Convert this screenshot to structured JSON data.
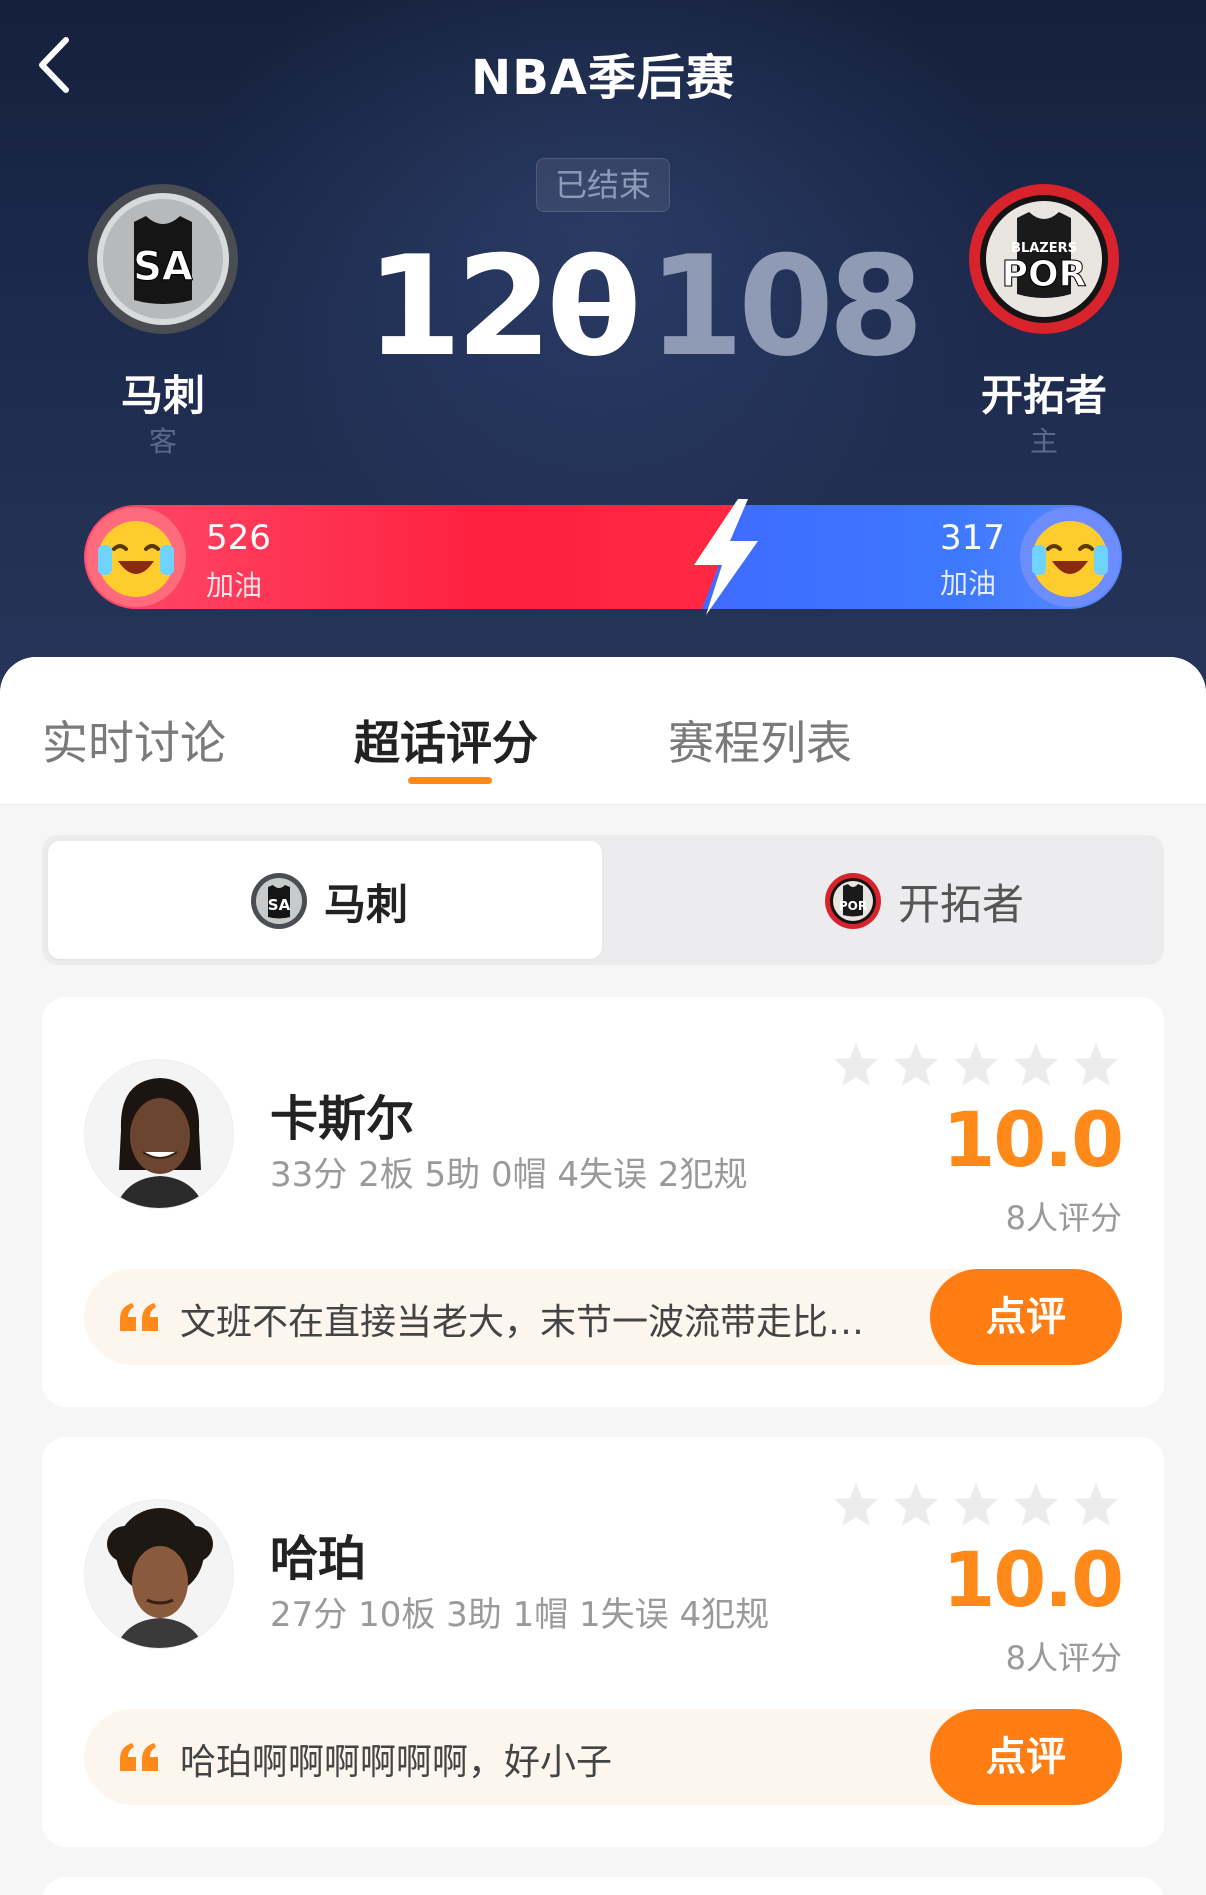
{
  "nav": {
    "title": "NBA季后赛"
  },
  "match": {
    "status": "已结束",
    "away": {
      "name": "马刺",
      "role": "客",
      "score": "120",
      "logo_text": "SA",
      "color": "#1a1a1a"
    },
    "home": {
      "name": "开拓者",
      "role": "主",
      "score": "108",
      "logo_text": "POR",
      "color": "#e0262e"
    }
  },
  "cheer": {
    "away_count": "526",
    "away_label": "加油",
    "home_count": "317",
    "home_label": "加油",
    "away_share": 0.624
  },
  "tabs": [
    {
      "label": "实时讨论",
      "active": false
    },
    {
      "label": "超话评分",
      "active": true
    },
    {
      "label": "赛程列表",
      "active": false
    }
  ],
  "team_switch": {
    "active": {
      "label": "马刺"
    },
    "inactive": {
      "label": "开拓者"
    }
  },
  "players": [
    {
      "name": "卡斯尔",
      "stats": "33分 2板 5助 0帽 4失误 2犯规",
      "score": "10.0",
      "rating_count": "8人评分",
      "comment": "文班不在直接当老大，末节一波流带走比赛…",
      "review_label": "点评"
    },
    {
      "name": "哈珀",
      "stats": "27分 10板 3助 1帽 1失误 4犯规",
      "score": "10.0",
      "rating_count": "8人评分",
      "comment": "哈珀啊啊啊啊啊啊，好小子",
      "review_label": "点评"
    }
  ],
  "colors": {
    "accent": "#ff8a1a",
    "cheer_red": "#ff1f3e",
    "cheer_blue": "#3d78ff"
  }
}
